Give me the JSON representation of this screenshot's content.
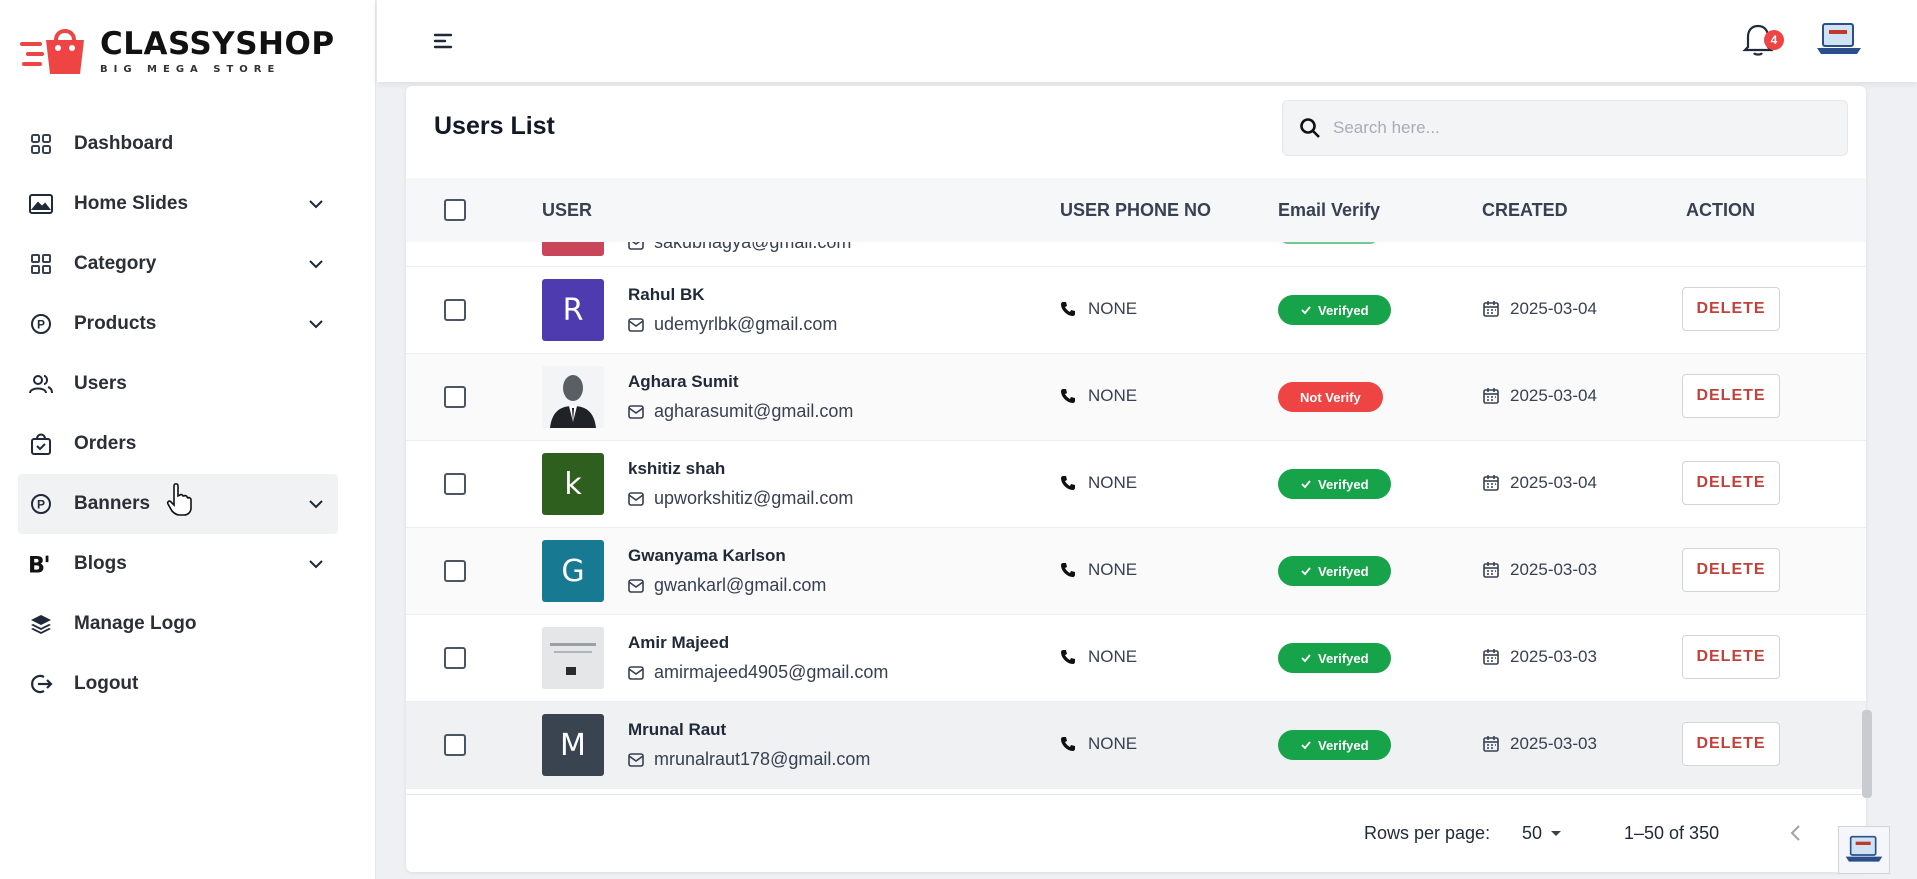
{
  "brand": {
    "name": "CLASSYSHOP",
    "tagline": "BIG MEGA STORE",
    "color": "#ef4444"
  },
  "sidebar": {
    "items": [
      {
        "label": "Dashboard",
        "icon": "dashboard-grid-icon",
        "has_submenu": false
      },
      {
        "label": "Home Slides",
        "icon": "image-icon",
        "has_submenu": true
      },
      {
        "label": "Category",
        "icon": "category-grid-icon",
        "has_submenu": true
      },
      {
        "label": "Products",
        "icon": "product-p-icon",
        "has_submenu": true
      },
      {
        "label": "Users",
        "icon": "users-icon",
        "has_submenu": false
      },
      {
        "label": "Orders",
        "icon": "shopping-bag-icon",
        "has_submenu": false
      },
      {
        "label": "Banners",
        "icon": "banner-p-icon",
        "has_submenu": true,
        "hovered": true
      },
      {
        "label": "Blogs",
        "icon": "blog-b-icon",
        "has_submenu": true
      },
      {
        "label": "Manage Logo",
        "icon": "layers-icon",
        "has_submenu": false
      },
      {
        "label": "Logout",
        "icon": "logout-icon",
        "has_submenu": false
      }
    ]
  },
  "header": {
    "notification_count": "4"
  },
  "users_list": {
    "title": "Users List",
    "search_placeholder": "Search here...",
    "columns": [
      "USER",
      "USER PHONE NO",
      "Email Verify",
      "CREATED",
      "ACTION"
    ],
    "partial_row_email": "sakubhagya@gmail.com",
    "rows": [
      {
        "name": "Rahul BK",
        "email": "udemyrlbk@gmail.com",
        "phone": "NONE",
        "verify": "Verifyed",
        "verified": true,
        "created": "2025-03-04",
        "action": "DELETE",
        "avatar_letter": "R",
        "avatar_color": "#4f3bb0"
      },
      {
        "name": "Aghara Sumit",
        "email": "agharasumit@gmail.com",
        "phone": "NONE",
        "verify": "Not Verify",
        "verified": false,
        "created": "2025-03-04",
        "action": "DELETE",
        "avatar_letter": "",
        "avatar_color": "#e5e7eb"
      },
      {
        "name": "kshitiz shah",
        "email": "upworkshitiz@gmail.com",
        "phone": "NONE",
        "verify": "Verifyed",
        "verified": true,
        "created": "2025-03-04",
        "action": "DELETE",
        "avatar_letter": "k",
        "avatar_color": "#2f5f1f"
      },
      {
        "name": "Gwanyama Karlson",
        "email": "gwankarl@gmail.com",
        "phone": "NONE",
        "verify": "Verifyed",
        "verified": true,
        "created": "2025-03-03",
        "action": "DELETE",
        "avatar_letter": "G",
        "avatar_color": "#177a92"
      },
      {
        "name": "Amir Majeed",
        "email": "amirmajeed4905@gmail.com",
        "phone": "NONE",
        "verify": "Verifyed",
        "verified": true,
        "created": "2025-03-03",
        "action": "DELETE",
        "avatar_letter": "",
        "avatar_color": "#d9dbdd"
      },
      {
        "name": "Mrunal Raut",
        "email": "mrunalraut178@gmail.com",
        "phone": "NONE",
        "verify": "Verifyed",
        "verified": true,
        "created": "2025-03-03",
        "action": "DELETE",
        "avatar_letter": "M",
        "avatar_color": "#3a4450"
      }
    ]
  },
  "pagination": {
    "rows_per_page_label": "Rows per page:",
    "rows_per_page": "50",
    "range": "1–50 of 350"
  },
  "colors": {
    "verified": "#16a34a",
    "not_verified": "#ef4444",
    "delete_text": "#c2413b"
  }
}
